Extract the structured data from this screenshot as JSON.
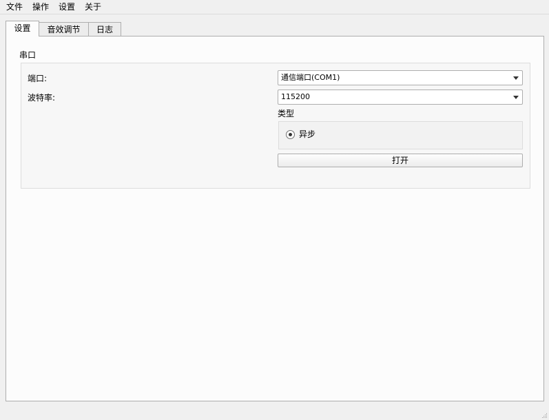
{
  "menubar": {
    "items": [
      {
        "label": "文件"
      },
      {
        "label": "操作"
      },
      {
        "label": "设置"
      },
      {
        "label": "关于"
      }
    ]
  },
  "tabs": [
    {
      "label": "设置",
      "active": true
    },
    {
      "label": "音效调节",
      "active": false
    },
    {
      "label": "日志",
      "active": false
    }
  ],
  "serial_group": {
    "title": "串口",
    "port_label": "端口:",
    "port_value": "通信端口(COM1)",
    "baud_label": "波特率:",
    "baud_value": "115200",
    "type_label": "类型",
    "type_option": "异步",
    "type_selected": true,
    "open_button": "打开"
  }
}
